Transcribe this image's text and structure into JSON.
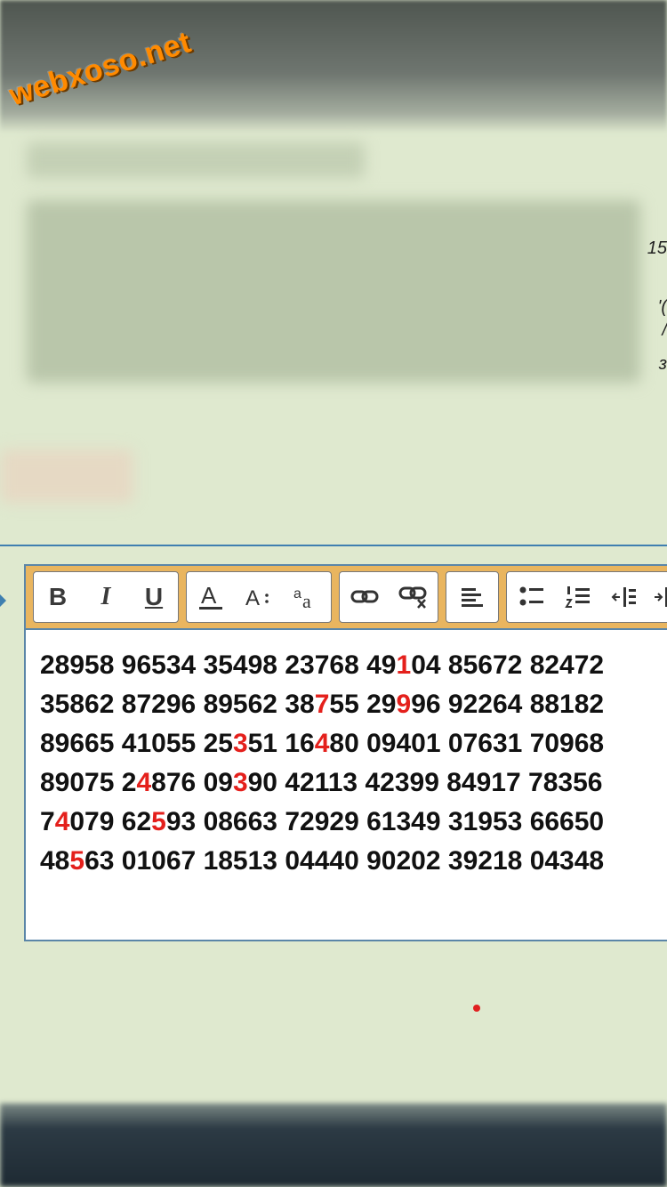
{
  "watermark": "webxoso.net",
  "side_fragments": [
    "15",
    "'(",
    "/",
    "ɜ"
  ],
  "toolbar": {
    "bold_label": "B",
    "italic_label": "I",
    "underline_label": "U",
    "font_color_icon": "font-color-icon",
    "font_size_icon": "font-size-icon",
    "font_family_icon": "font-family-icon",
    "link_icon": "link-icon",
    "unlink_icon": "unlink-icon",
    "align_icon": "align-left-icon",
    "bullet_list_icon": "bullet-list-icon",
    "numbered_list_icon": "numbered-list-icon",
    "outdent_icon": "outdent-icon",
    "indent_icon": "indent-icon"
  },
  "editor": {
    "rows": [
      [
        "28958",
        "96534",
        "35498",
        "23768",
        "49104",
        "85672",
        "82472"
      ],
      [
        "35862",
        "87296",
        "89562",
        "38755",
        "29996",
        "92264",
        "88182"
      ],
      [
        "89665",
        "41055",
        "25351",
        "16480",
        "09401",
        "07631",
        "70968"
      ],
      [
        "89075",
        "24876",
        "09390",
        "42113",
        "42399",
        "84917",
        "78356"
      ],
      [
        "74079",
        "62593",
        "08663",
        "72929",
        "61349",
        "31953",
        "66650"
      ],
      [
        "48563",
        "01067",
        "18513",
        "04440",
        "90202",
        "39218",
        "04348"
      ]
    ],
    "highlights": [
      {
        "row": 0,
        "group": 4,
        "char": 2
      },
      {
        "row": 1,
        "group": 3,
        "char": 2
      },
      {
        "row": 1,
        "group": 4,
        "char": 2
      },
      {
        "row": 2,
        "group": 2,
        "char": 2
      },
      {
        "row": 2,
        "group": 3,
        "char": 2
      },
      {
        "row": 3,
        "group": 1,
        "char": 1
      },
      {
        "row": 3,
        "group": 2,
        "char": 2
      },
      {
        "row": 4,
        "group": 0,
        "char": 1
      },
      {
        "row": 4,
        "group": 1,
        "char": 2
      },
      {
        "row": 5,
        "group": 0,
        "char": 2
      }
    ],
    "highlight_color": "#e4201c"
  },
  "colors": {
    "background": "#dfe9cf",
    "toolbar": "#e9b55f",
    "border": "#5b86a8"
  }
}
